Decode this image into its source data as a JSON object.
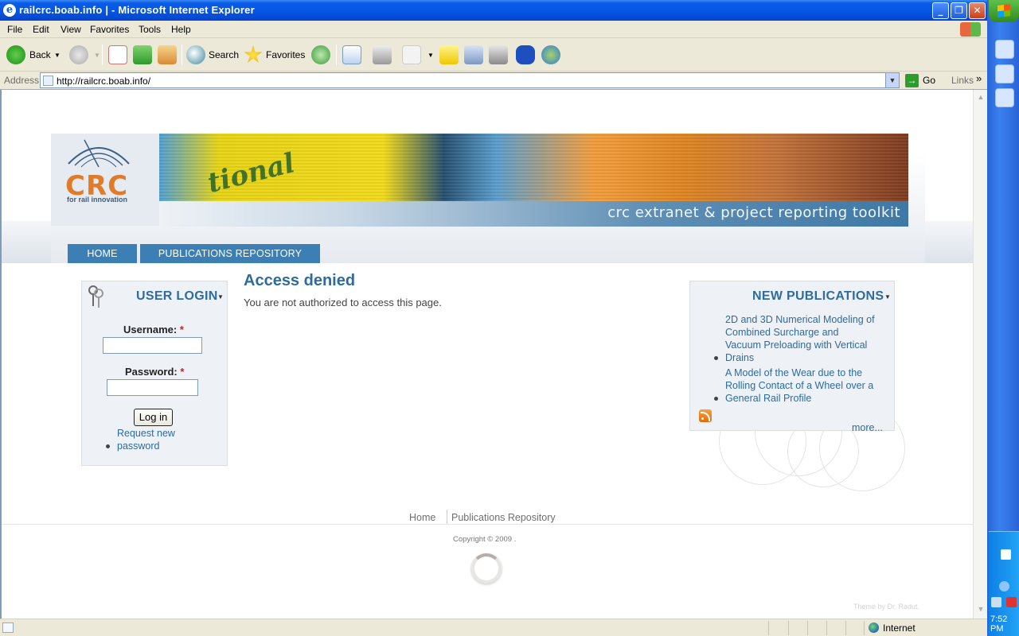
{
  "window": {
    "title": "railcrc.boab.info | - Microsoft Internet Explorer",
    "min": "_",
    "max": "❐",
    "close": "✕"
  },
  "menu": {
    "file": "File",
    "edit": "Edit",
    "view": "View",
    "favorites": "Favorites",
    "tools": "Tools",
    "help": "Help"
  },
  "toolbar": {
    "back": "Back",
    "search": "Search",
    "favorites": "Favorites"
  },
  "address": {
    "label": "Address",
    "url": "http://railcrc.boab.info/",
    "go": "Go",
    "links": "Links"
  },
  "site": {
    "logo_text": "CRC",
    "logo_tagline": "for rail innovation",
    "header_tagline": "crc extranet & project reporting toolkit",
    "nav": {
      "home": "HOME",
      "publications": "PUBLICATIONS REPOSITORY"
    }
  },
  "login": {
    "title": "USER LOGIN",
    "username_label": "Username:",
    "password_label": "Password:",
    "required_mark": "*",
    "button": "Log in",
    "request_line1": "Request new",
    "request_line2": "password"
  },
  "main": {
    "title": "Access denied",
    "message": "You are not authorized to access this page."
  },
  "publications": {
    "title": "NEW PUBLICATIONS",
    "items": [
      {
        "line1": "2D and 3D Numerical Modeling of",
        "line2": "Combined Surcharge and",
        "line3": "Vacuum Preloading with Vertical",
        "line4": "Drains"
      },
      {
        "line1": "A Model of the Wear due to the",
        "line2": "Rolling Contact of a Wheel over a",
        "line3": "General Rail Profile"
      }
    ],
    "more": "more..."
  },
  "footer": {
    "home": "Home",
    "publications": "Publications Repository",
    "copyright": "Copyright © 2009 .",
    "theme": "Theme by Dr. Radut."
  },
  "status": {
    "zone": "Internet"
  },
  "taskbar": {
    "time": "7:52 PM"
  }
}
